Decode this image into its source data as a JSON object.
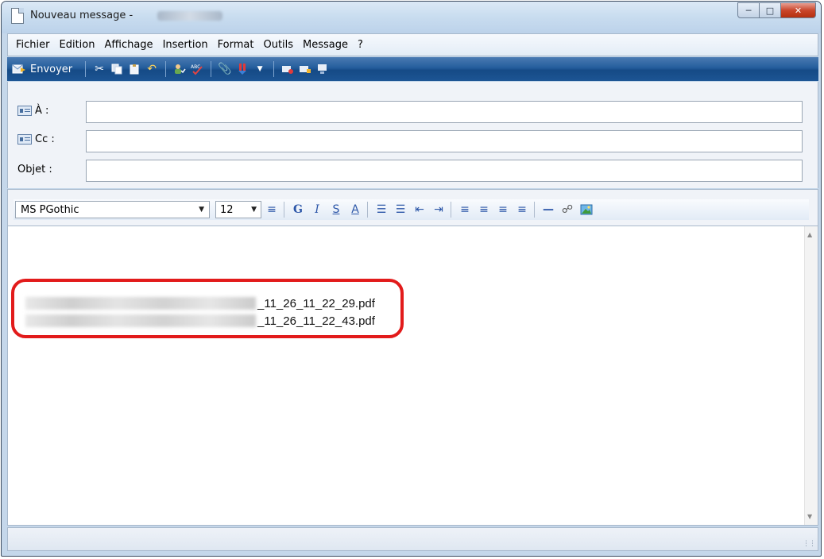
{
  "window": {
    "title": "Nouveau message -"
  },
  "menu": {
    "items": [
      "Fichier",
      "Edition",
      "Affichage",
      "Insertion",
      "Format",
      "Outils",
      "Message",
      "?"
    ]
  },
  "toolbar": {
    "send_label": "Envoyer",
    "icons": [
      "cut-icon",
      "copy-icon",
      "paste-icon",
      "undo-icon",
      "check-names-icon",
      "spelling-icon",
      "attach-icon",
      "priority-icon",
      "sign-icon",
      "encrypt-icon",
      "offline-icon"
    ]
  },
  "headers": {
    "to_label": "À :",
    "cc_label": "Cc :",
    "subject_label": "Objet :",
    "to_value": "",
    "cc_value": "",
    "subject_value": ""
  },
  "format": {
    "font_name": "MS PGothic",
    "font_size": "12"
  },
  "attachments": [
    {
      "suffix": "_11_26_11_22_29.pdf"
    },
    {
      "suffix": "_11_26_11_22_43.pdf"
    }
  ],
  "colors": {
    "toolbar_blue": "#1d5594",
    "highlight_red": "#e21b1b"
  }
}
